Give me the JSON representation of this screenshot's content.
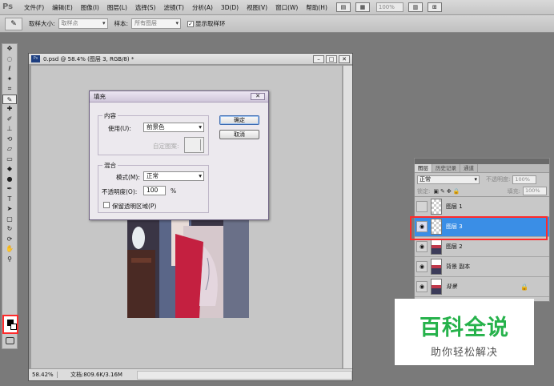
{
  "app": {
    "logo": "Ps",
    "menu": [
      "文件(F)",
      "编辑(E)",
      "图像(I)",
      "图层(L)",
      "选择(S)",
      "滤镜(T)",
      "分析(A)",
      "3D(D)",
      "视图(V)",
      "窗口(W)",
      "帮助(H)"
    ],
    "zoom_display": "100%"
  },
  "options_bar": {
    "sample_size_label": "取样大小:",
    "sample_size_value": "取样点",
    "sample_label": "样本:",
    "sample_value": "所有图层",
    "show_ring_label": "显示取样环",
    "show_ring_checked": true
  },
  "document": {
    "title": "0.psd @ 58.4% (图层 3, RGB/8) *",
    "zoom": "58.42%",
    "doc_info": "文档:809.6K/3.16M"
  },
  "fill_dialog": {
    "title": "填充",
    "contents_group": "内容",
    "use_label": "使用(U):",
    "use_value": "前景色",
    "custom_pattern_label": "自定图案:",
    "blending_group": "混合",
    "mode_label": "模式(M):",
    "mode_value": "正常",
    "opacity_label": "不透明度(O):",
    "opacity_value": "100",
    "opacity_unit": "%",
    "preserve_label": "保留透明区域(P)",
    "preserve_checked": false,
    "ok_label": "确定",
    "cancel_label": "取消"
  },
  "layers_panel": {
    "tabs": [
      "图层",
      "历史记录",
      "通道"
    ],
    "active_tab": 0,
    "blend_mode": "正常",
    "opacity_label": "不透明度:",
    "opacity_value": "100%",
    "lock_label": "锁定:",
    "fill_label": "填充:",
    "fill_value": "100%",
    "layers": [
      {
        "name": "图层 1",
        "visible": false,
        "thumb": "transparent",
        "selected": false,
        "locked": false
      },
      {
        "name": "图层 3",
        "visible": true,
        "thumb": "transparent",
        "selected": true,
        "locked": false
      },
      {
        "name": "图层 2",
        "visible": true,
        "thumb": "image",
        "selected": false,
        "locked": false
      },
      {
        "name": "背景 副本",
        "visible": true,
        "thumb": "image",
        "selected": false,
        "locked": false
      },
      {
        "name": "背景",
        "visible": true,
        "thumb": "image",
        "selected": false,
        "locked": true
      }
    ]
  },
  "watermark": {
    "title": "百科全说",
    "subtitle": "助你轻松解决"
  },
  "colors": {
    "highlight": "#ff2a2a",
    "selected_layer": "#3a8ee6",
    "watermark_green": "#26b24b"
  }
}
